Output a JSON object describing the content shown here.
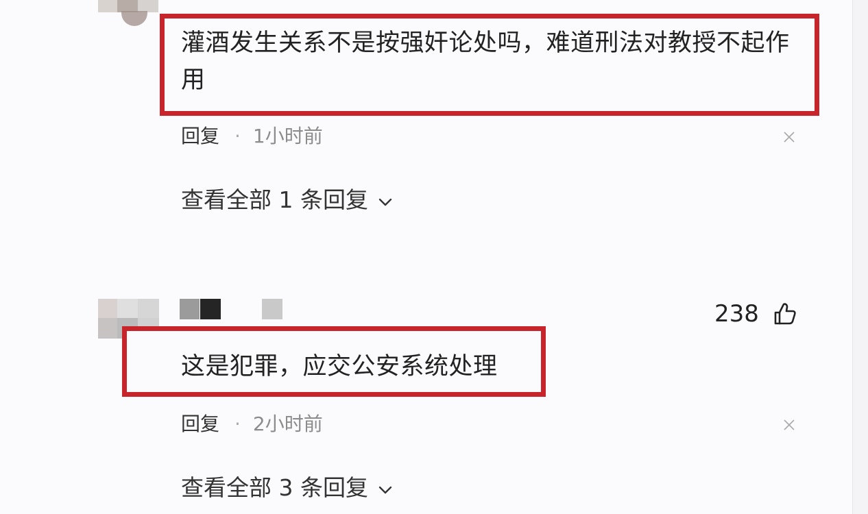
{
  "comments": [
    {
      "text": "灌酒发生关系不是按强奸论处吗，难道刑法对教授不起作用",
      "reply_label": "回复",
      "time": "1小时前",
      "view_replies": "查看全部 1 条回复"
    },
    {
      "text": "这是犯罪，应交公安系统处理",
      "reply_label": "回复",
      "time": "2小时前",
      "view_replies": "查看全部 3 条回复",
      "likes": "238"
    }
  ],
  "separator": "·",
  "icons": {
    "close": "close-icon",
    "chevron": "chevron-down-icon",
    "like": "thumbs-up-icon"
  },
  "colors": {
    "highlight_border": "#c8242b",
    "text": "#222222",
    "secondary_text": "#8c8c8c"
  }
}
